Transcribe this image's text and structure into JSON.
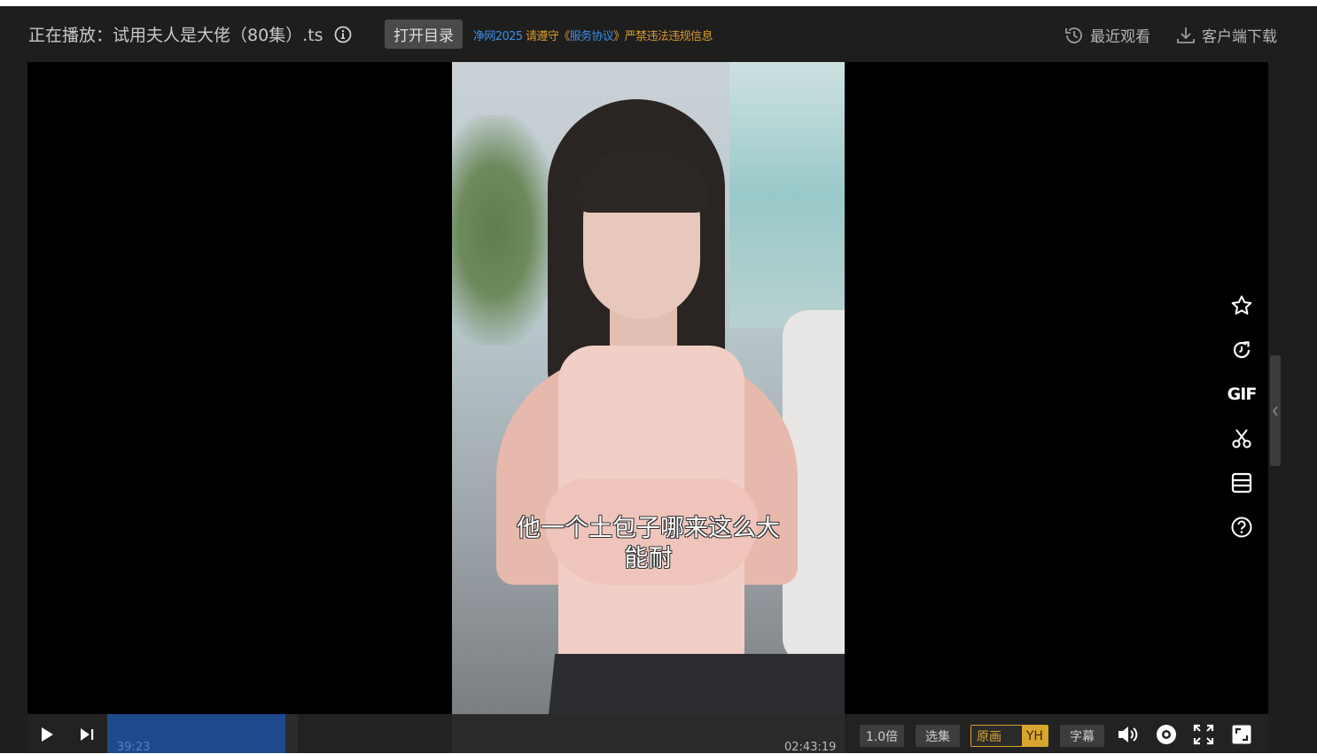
{
  "header": {
    "now_playing_label": "正在播放：",
    "file_title": "试用夫人是大佬（80集）.ts",
    "open_catalog_label": "打开目录",
    "notice_part1": "净网2025 ",
    "notice_part2": "请遵守《",
    "notice_part3": "服务协议",
    "notice_part4": "》严禁违法违规信息",
    "recent_label": "最近观看",
    "download_label": "客户端下载"
  },
  "video": {
    "subtitle_line1": "他一个土包子哪来这么大",
    "subtitle_line2": "能耐"
  },
  "side_tools": {
    "gif_label": "GIF",
    "items": [
      "star-icon",
      "refresh-icon",
      "gif-icon",
      "scissors-icon",
      "list-icon",
      "help-icon"
    ]
  },
  "controls": {
    "current_time": "39:23",
    "total_time": "02:43:19",
    "progress_fraction": 0.24,
    "speed_label": "1.0倍",
    "episodes_label": "选集",
    "quality_label": "原画",
    "quality_tag": "YH",
    "subtitle_label": "字幕"
  },
  "colors": {
    "accent_blue": "#3b8ee8",
    "accent_orange": "#d99a2a",
    "quality_gold": "#d8a630",
    "progress_blue": "#1e4a8c"
  }
}
